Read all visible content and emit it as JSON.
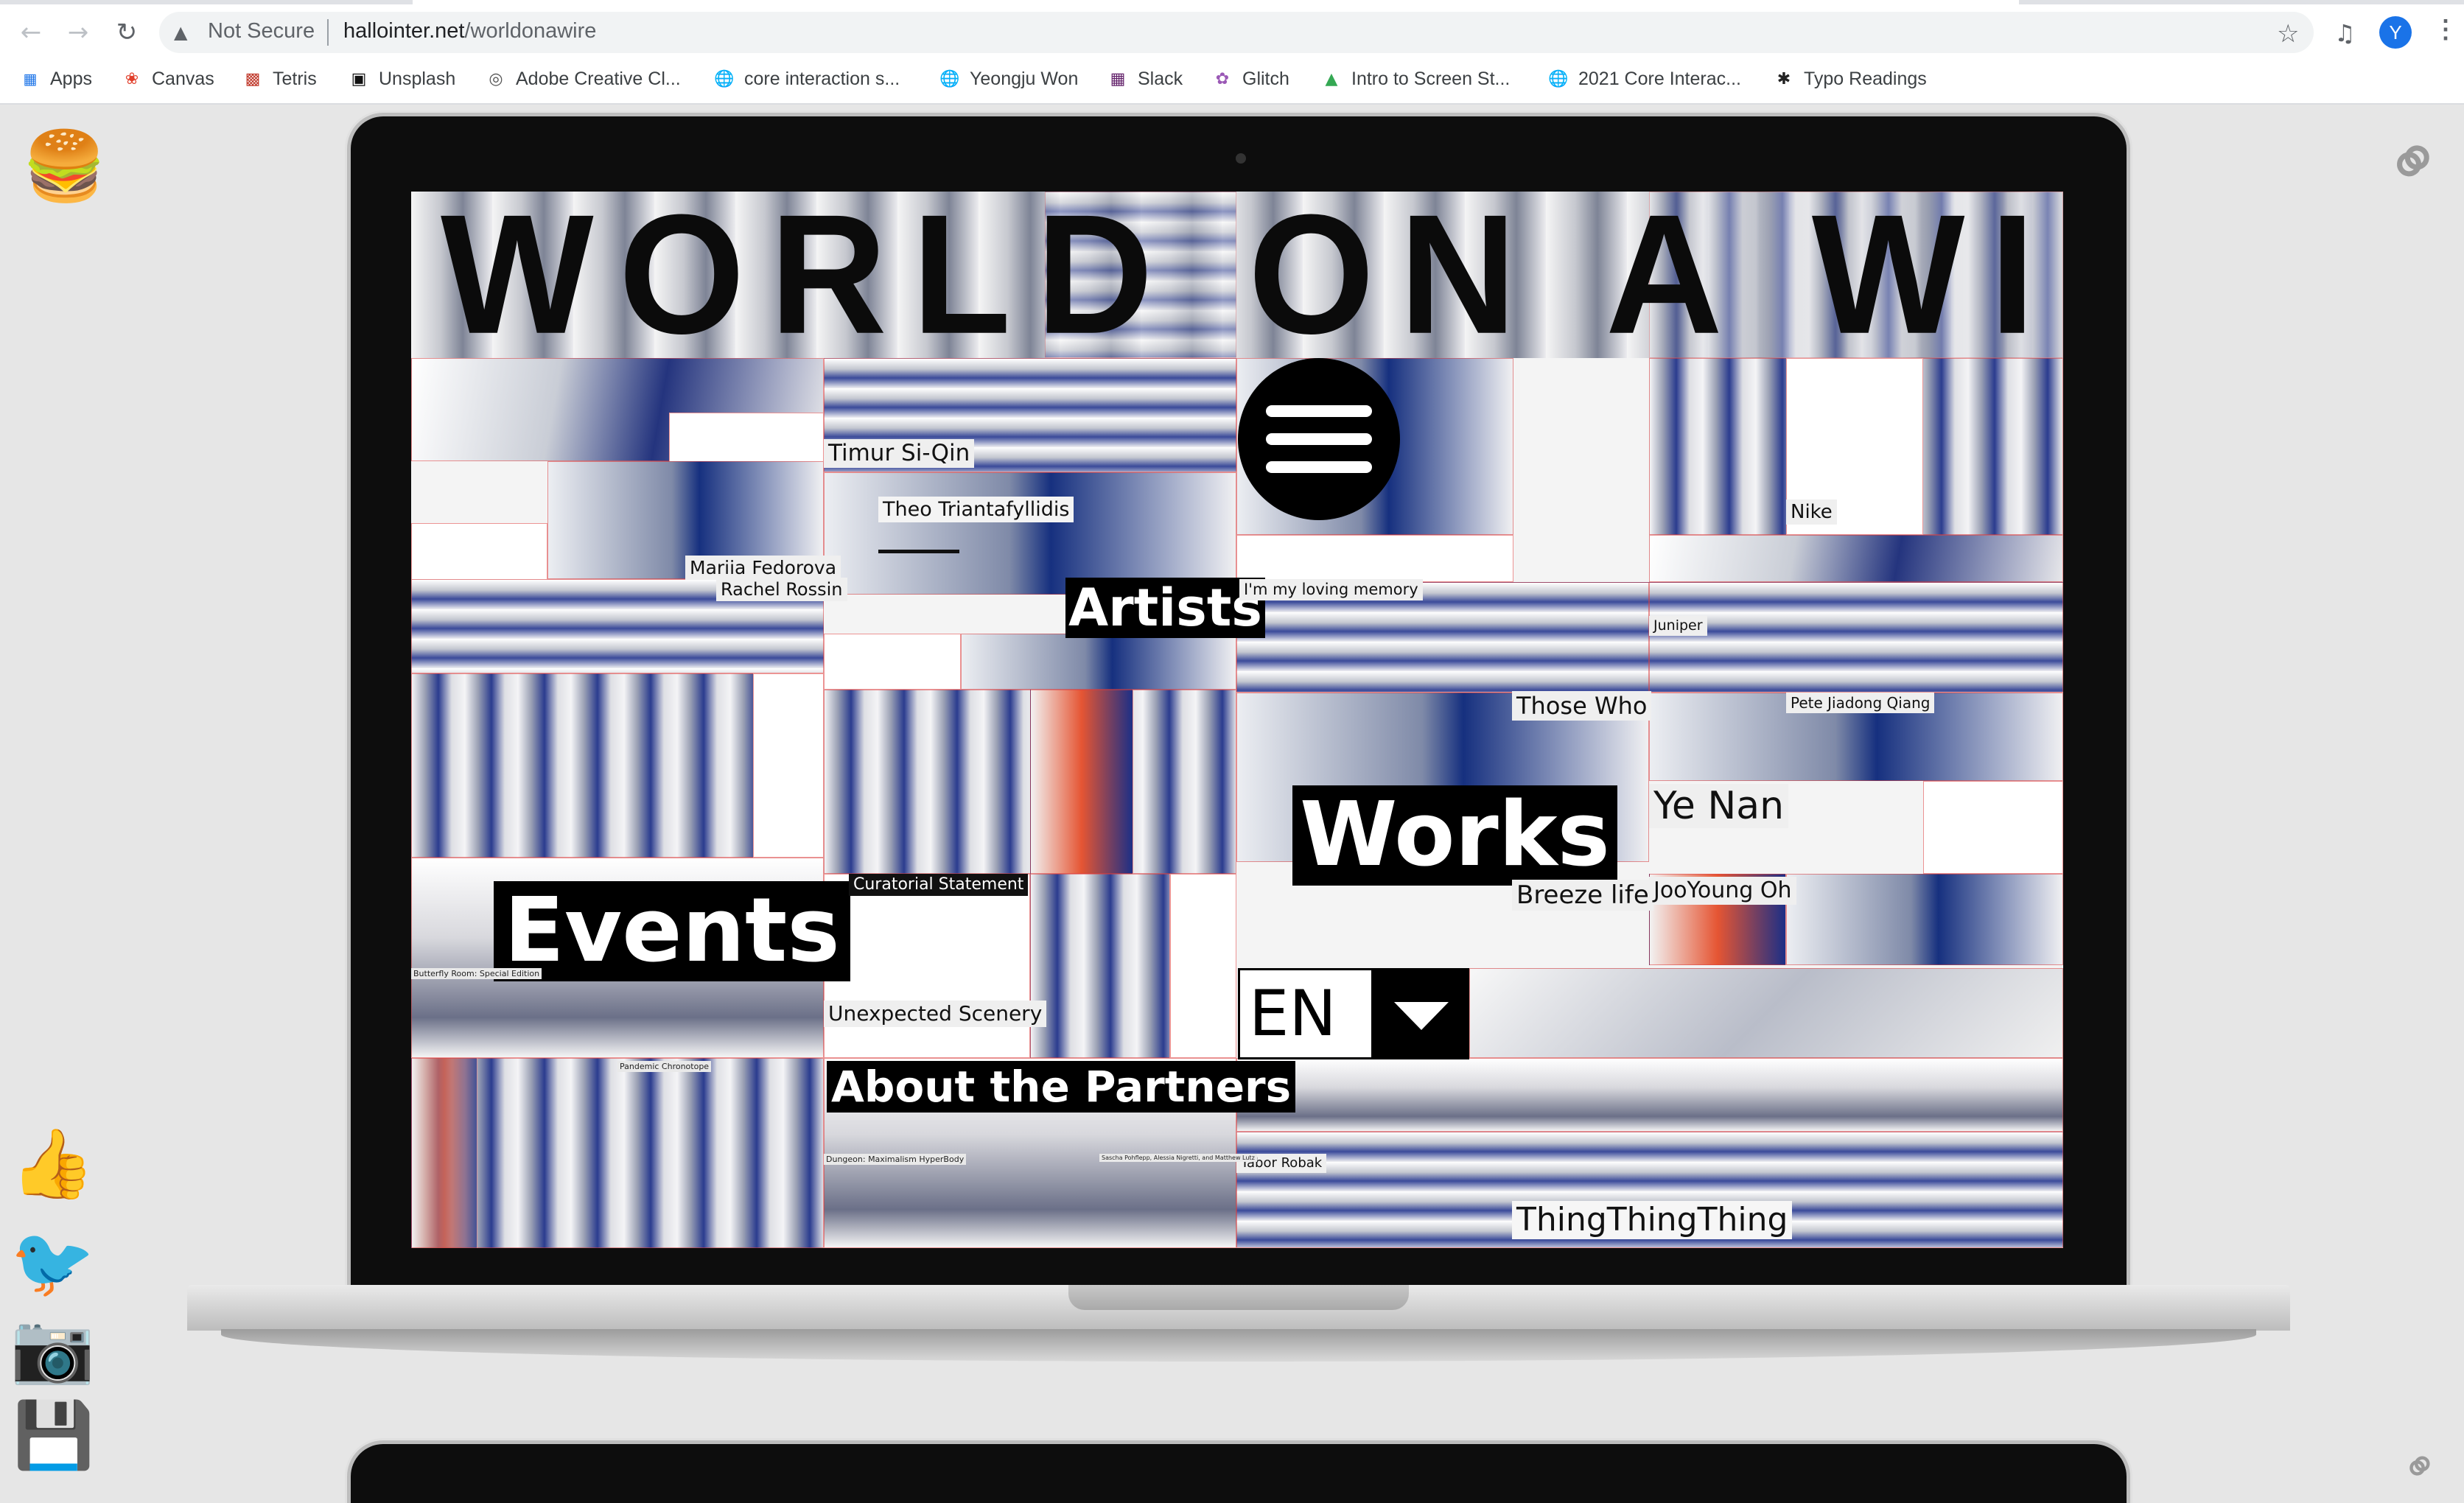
{
  "browser": {
    "security_label": "Not Secure",
    "url_domain": "hallointer.net",
    "url_path": "/worldonawire",
    "profile_initial": "Y",
    "bookmarks": [
      "Apps",
      "Canvas",
      "Tetris",
      "Unsplash",
      "Adobe Creative Cl...",
      "core interaction s...",
      "Yeongju Won",
      "Slack",
      "Glitch",
      "Intro to Screen St...",
      "2021 Core Interac...",
      "Typo Readings"
    ]
  },
  "page": {
    "side_icons": {
      "left": [
        "hamburger-emoji",
        "thumbs-up-emoji",
        "bird-emoji",
        "camera-emoji",
        "floppy-disk-emoji"
      ],
      "right": [
        "link-icon"
      ]
    }
  },
  "site": {
    "title": "WORLD ON A WIRE",
    "nav": {
      "artists": "Artists",
      "works": "Works",
      "events": "Events",
      "about": "About the Partners",
      "language": "EN"
    },
    "names": {
      "timur": "Timur Si-Qin",
      "theo": "Theo Triantafyllidis",
      "mariia": "Mariia Fedorova",
      "rachel": "Rachel Rossin",
      "nike": "Nike",
      "memory": "I'm my loving memory",
      "juniper": "Juniper",
      "those_who": "Those Who",
      "pete": "Pete Jiadong Qiang",
      "ye_nan": "Ye Nan",
      "breeze": "Breeze life",
      "jooyoung": "JooYoung Oh",
      "curatorial": "Curatorial Statement",
      "unexpected": "Unexpected Scenery",
      "tabor": "Tabor Robak",
      "thing": "ThingThingThing"
    },
    "tiny_labels": {
      "butterfly": "Butterfly Room: Special Edition",
      "pandemic": "Pandemic Chronotope",
      "dungeon": "Dungeon: Maximalism HyperBody",
      "credit": "Sascha Pohflepp, Alessia Nigretti, and Matthew Lutz"
    }
  }
}
